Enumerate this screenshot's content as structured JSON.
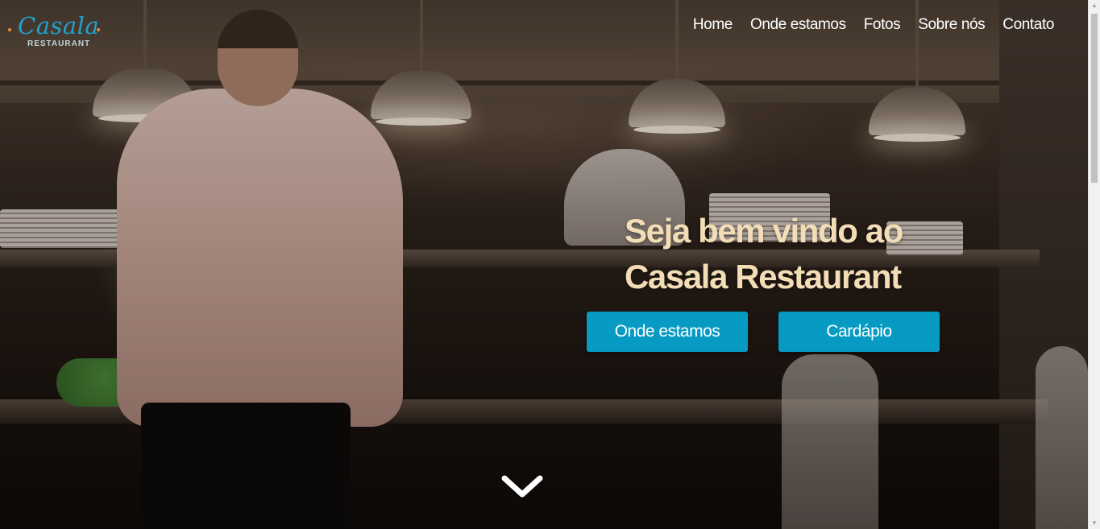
{
  "brand": {
    "logo_word": "Casala",
    "logo_sub": "RESTAURANT"
  },
  "nav": {
    "items": [
      {
        "label": "Home"
      },
      {
        "label": "Onde estamos"
      },
      {
        "label": "Fotos"
      },
      {
        "label": "Sobre nós"
      },
      {
        "label": "Contato"
      }
    ]
  },
  "hero": {
    "headline_line1": "Seja bem vindo ao",
    "headline_line2": "Casala Restaurant",
    "buttons": {
      "location_label": "Onde estamos",
      "menu_label": "Cardápio"
    },
    "scroll_icon": "chevron-down-icon"
  },
  "colors": {
    "accent": "#079bc3",
    "headline": "#f2ddb7",
    "logo": "#1fa2cf",
    "logo_dot": "#e8893a"
  }
}
